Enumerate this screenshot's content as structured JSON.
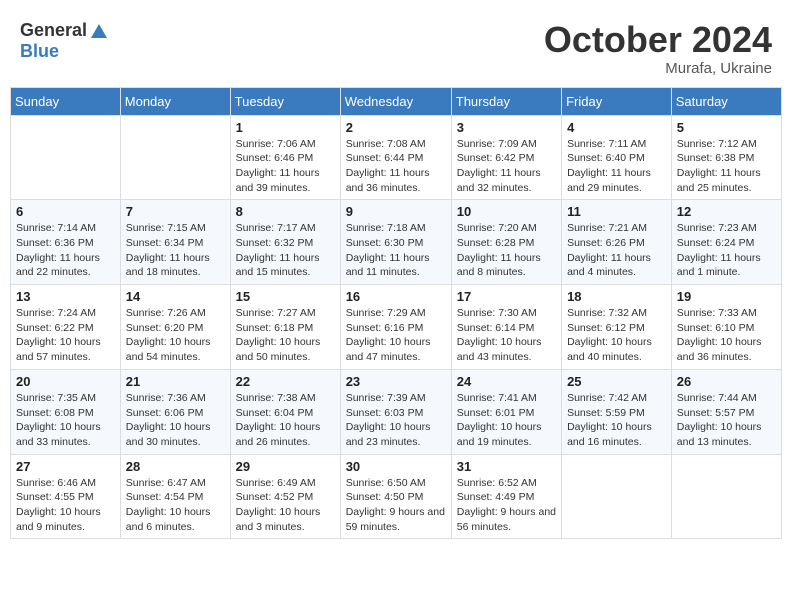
{
  "header": {
    "logo_general": "General",
    "logo_blue": "Blue",
    "month_title": "October 2024",
    "subtitle": "Murafa, Ukraine"
  },
  "weekdays": [
    "Sunday",
    "Monday",
    "Tuesday",
    "Wednesday",
    "Thursday",
    "Friday",
    "Saturday"
  ],
  "days": {
    "1": {
      "sunrise": "7:06 AM",
      "sunset": "6:46 PM",
      "daylight": "11 hours and 39 minutes."
    },
    "2": {
      "sunrise": "7:08 AM",
      "sunset": "6:44 PM",
      "daylight": "11 hours and 36 minutes."
    },
    "3": {
      "sunrise": "7:09 AM",
      "sunset": "6:42 PM",
      "daylight": "11 hours and 32 minutes."
    },
    "4": {
      "sunrise": "7:11 AM",
      "sunset": "6:40 PM",
      "daylight": "11 hours and 29 minutes."
    },
    "5": {
      "sunrise": "7:12 AM",
      "sunset": "6:38 PM",
      "daylight": "11 hours and 25 minutes."
    },
    "6": {
      "sunrise": "7:14 AM",
      "sunset": "6:36 PM",
      "daylight": "11 hours and 22 minutes."
    },
    "7": {
      "sunrise": "7:15 AM",
      "sunset": "6:34 PM",
      "daylight": "11 hours and 18 minutes."
    },
    "8": {
      "sunrise": "7:17 AM",
      "sunset": "6:32 PM",
      "daylight": "11 hours and 15 minutes."
    },
    "9": {
      "sunrise": "7:18 AM",
      "sunset": "6:30 PM",
      "daylight": "11 hours and 11 minutes."
    },
    "10": {
      "sunrise": "7:20 AM",
      "sunset": "6:28 PM",
      "daylight": "11 hours and 8 minutes."
    },
    "11": {
      "sunrise": "7:21 AM",
      "sunset": "6:26 PM",
      "daylight": "11 hours and 4 minutes."
    },
    "12": {
      "sunrise": "7:23 AM",
      "sunset": "6:24 PM",
      "daylight": "11 hours and 1 minute."
    },
    "13": {
      "sunrise": "7:24 AM",
      "sunset": "6:22 PM",
      "daylight": "10 hours and 57 minutes."
    },
    "14": {
      "sunrise": "7:26 AM",
      "sunset": "6:20 PM",
      "daylight": "10 hours and 54 minutes."
    },
    "15": {
      "sunrise": "7:27 AM",
      "sunset": "6:18 PM",
      "daylight": "10 hours and 50 minutes."
    },
    "16": {
      "sunrise": "7:29 AM",
      "sunset": "6:16 PM",
      "daylight": "10 hours and 47 minutes."
    },
    "17": {
      "sunrise": "7:30 AM",
      "sunset": "6:14 PM",
      "daylight": "10 hours and 43 minutes."
    },
    "18": {
      "sunrise": "7:32 AM",
      "sunset": "6:12 PM",
      "daylight": "10 hours and 40 minutes."
    },
    "19": {
      "sunrise": "7:33 AM",
      "sunset": "6:10 PM",
      "daylight": "10 hours and 36 minutes."
    },
    "20": {
      "sunrise": "7:35 AM",
      "sunset": "6:08 PM",
      "daylight": "10 hours and 33 minutes."
    },
    "21": {
      "sunrise": "7:36 AM",
      "sunset": "6:06 PM",
      "daylight": "10 hours and 30 minutes."
    },
    "22": {
      "sunrise": "7:38 AM",
      "sunset": "6:04 PM",
      "daylight": "10 hours and 26 minutes."
    },
    "23": {
      "sunrise": "7:39 AM",
      "sunset": "6:03 PM",
      "daylight": "10 hours and 23 minutes."
    },
    "24": {
      "sunrise": "7:41 AM",
      "sunset": "6:01 PM",
      "daylight": "10 hours and 19 minutes."
    },
    "25": {
      "sunrise": "7:42 AM",
      "sunset": "5:59 PM",
      "daylight": "10 hours and 16 minutes."
    },
    "26": {
      "sunrise": "7:44 AM",
      "sunset": "5:57 PM",
      "daylight": "10 hours and 13 minutes."
    },
    "27": {
      "sunrise": "6:46 AM",
      "sunset": "4:55 PM",
      "daylight": "10 hours and 9 minutes."
    },
    "28": {
      "sunrise": "6:47 AM",
      "sunset": "4:54 PM",
      "daylight": "10 hours and 6 minutes."
    },
    "29": {
      "sunrise": "6:49 AM",
      "sunset": "4:52 PM",
      "daylight": "10 hours and 3 minutes."
    },
    "30": {
      "sunrise": "6:50 AM",
      "sunset": "4:50 PM",
      "daylight": "9 hours and 59 minutes."
    },
    "31": {
      "sunrise": "6:52 AM",
      "sunset": "4:49 PM",
      "daylight": "9 hours and 56 minutes."
    }
  },
  "labels": {
    "sunrise": "Sunrise:",
    "sunset": "Sunset:",
    "daylight": "Daylight:"
  }
}
